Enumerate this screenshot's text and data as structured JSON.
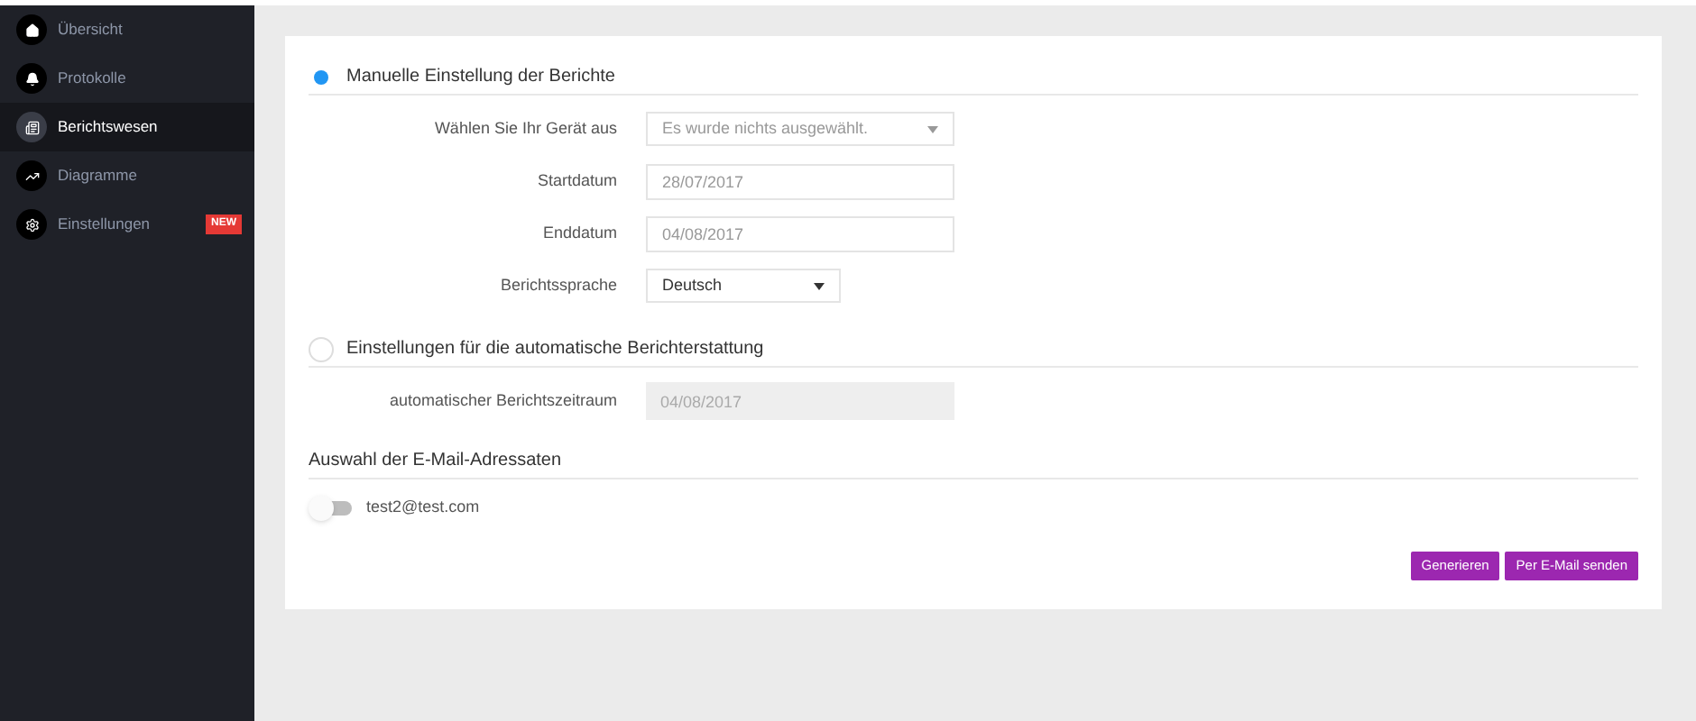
{
  "sidebar": {
    "items": [
      {
        "kind": "home",
        "label": "Übersicht",
        "selected": false
      },
      {
        "kind": "bell",
        "label": "Protokolle",
        "selected": false
      },
      {
        "kind": "report",
        "label": "Berichtswesen",
        "selected": true
      },
      {
        "kind": "chart",
        "label": "Diagramme",
        "selected": false
      },
      {
        "kind": "gear",
        "label": "Einstellungen",
        "selected": false,
        "badge": "NEW"
      }
    ]
  },
  "manual": {
    "title": "Manuelle Einstellung der Berichte",
    "selected": true,
    "fields": [
      {
        "kind": "select",
        "label": "Wählen Sie Ihr Gerät aus",
        "placeholder": "Es wurde nichts ausgewählt."
      },
      {
        "kind": "input",
        "label": "Startdatum",
        "placeholder": "28/07/2017"
      },
      {
        "kind": "input",
        "label": "Enddatum",
        "placeholder": "04/08/2017"
      },
      {
        "kind": "dropdown",
        "label": "Berichtssprache",
        "value": "Deutsch"
      }
    ]
  },
  "automatic": {
    "title": "Einstellungen für die automatische Berichterstattung",
    "selected": false,
    "fields": [
      {
        "kind": "disabled",
        "label": "automatischer Berichtszeitraum",
        "placeholder": "04/08/2017"
      }
    ]
  },
  "recipients": {
    "title": "Auswahl der E-Mail-Adressaten",
    "items": [
      {
        "email": "test2@test.com",
        "on": false
      }
    ]
  },
  "buttons": [
    "Generieren",
    "Per E-Mail senden"
  ]
}
